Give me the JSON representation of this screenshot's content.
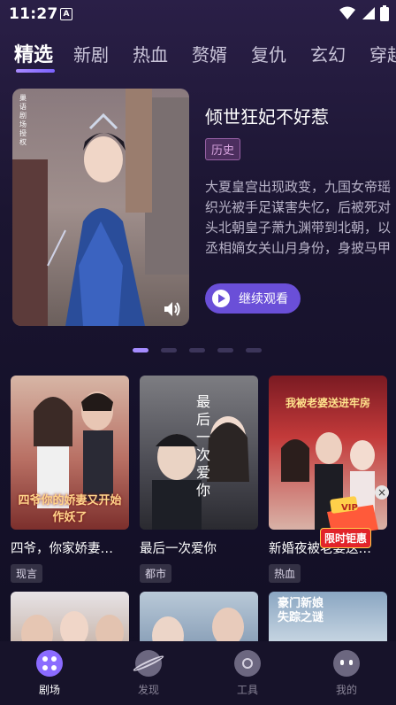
{
  "status": {
    "time": "11:27",
    "notif_letter": "A"
  },
  "tabs": [
    "精选",
    "新剧",
    "热血",
    "赘婿",
    "复仇",
    "玄幻",
    "穿越"
  ],
  "banner": {
    "title": "倾世狂妃不好惹",
    "tag": "历史",
    "description": "大夏皇宫出现政变，九国女帝瑶织光被手足谋害失忆，后被死对头北朝皇子萧九渊带到北朝，以丞相嫡女关山月身份，身披马甲扮猪吃老虎，却阴…",
    "continue_label": "继续观看",
    "poster_watermark": "巢语剧场授权"
  },
  "cards": [
    {
      "title": "四爷，你家娇妻…",
      "genre": "现言",
      "cover_text": "四爷你的娇妻又开始作妖了"
    },
    {
      "title": "最后一次爱你",
      "genre": "都市",
      "cover_text": "最后一次爱你"
    },
    {
      "title": "新婚夜被老婆送…",
      "genre": "热血",
      "cover_text": "我被老婆送进牢房"
    }
  ],
  "row2_covers": [
    "",
    "",
    "豪门新娘失踪之谜"
  ],
  "promo": {
    "badge": "VIP",
    "label": "限时钜惠"
  },
  "bottom_nav": [
    {
      "label": "剧场",
      "active": true
    },
    {
      "label": "发现",
      "active": false
    },
    {
      "label": "工具",
      "active": false
    },
    {
      "label": "我的",
      "active": false
    }
  ]
}
